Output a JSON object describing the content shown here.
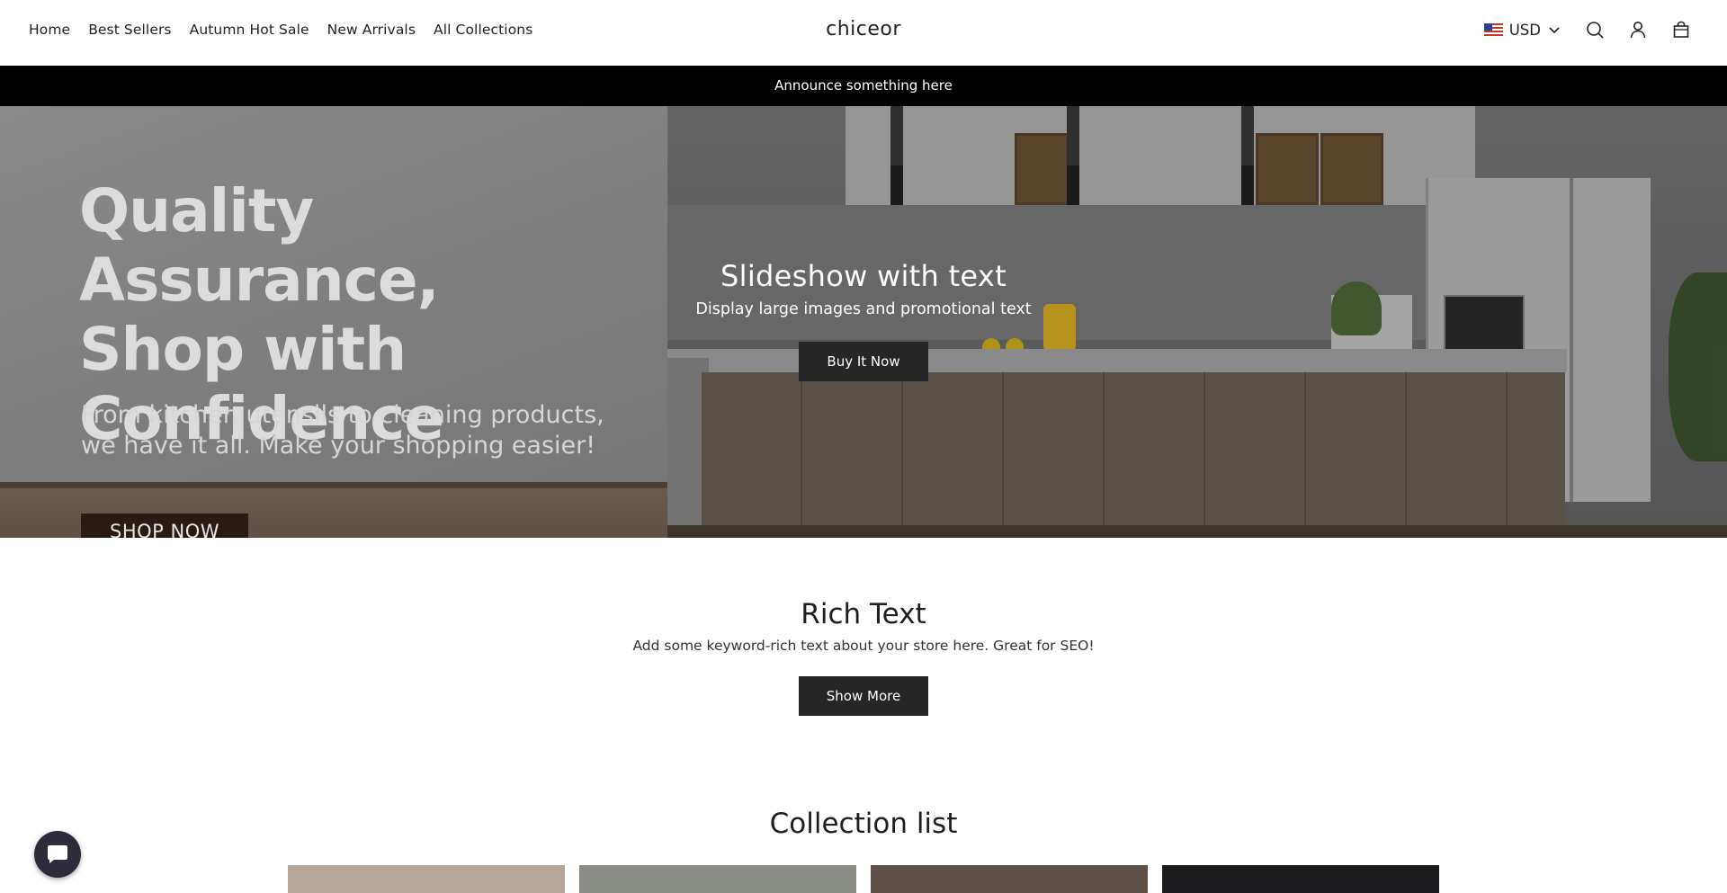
{
  "header": {
    "nav": [
      "Home",
      "Best Sellers",
      "Autumn Hot Sale",
      "New Arrivals",
      "All Collections"
    ],
    "logo": "chiceor",
    "currency": "USD",
    "icons": [
      "us-flag-icon",
      "chevron-down-icon",
      "search-icon",
      "account-icon",
      "cart-icon"
    ]
  },
  "announcement": "Announce something here",
  "hero": {
    "banner_headline": [
      "Quality Assurance,",
      "Shop with",
      "Confidence"
    ],
    "banner_sub": [
      "From kitchen utensils to cleaning products,",
      "we have it all. Make your shopping easier!"
    ],
    "banner_button": "SHOP NOW",
    "title": "Slideshow with text",
    "subtitle": "Display large images and promotional text",
    "button": "Buy It Now"
  },
  "rich_text": {
    "title": "Rich Text",
    "body": "Add some keyword-rich text about your store here. Great for SEO!",
    "button": "Show More"
  },
  "collection_list": {
    "title": "Collection list",
    "cards": [
      {
        "name": "collection-card-1",
        "color": "#b6a79a"
      },
      {
        "name": "collection-card-2",
        "color": "#8a8d86"
      },
      {
        "name": "collection-card-3",
        "color": "#5e5047"
      },
      {
        "name": "collection-card-4",
        "color": "#1c1c1e"
      }
    ]
  },
  "colors": {
    "announcement_bg": "#000000",
    "button_bg": "#262626",
    "chat_bg": "#2b2b3a"
  },
  "chat": {
    "icon": "chat-icon"
  }
}
